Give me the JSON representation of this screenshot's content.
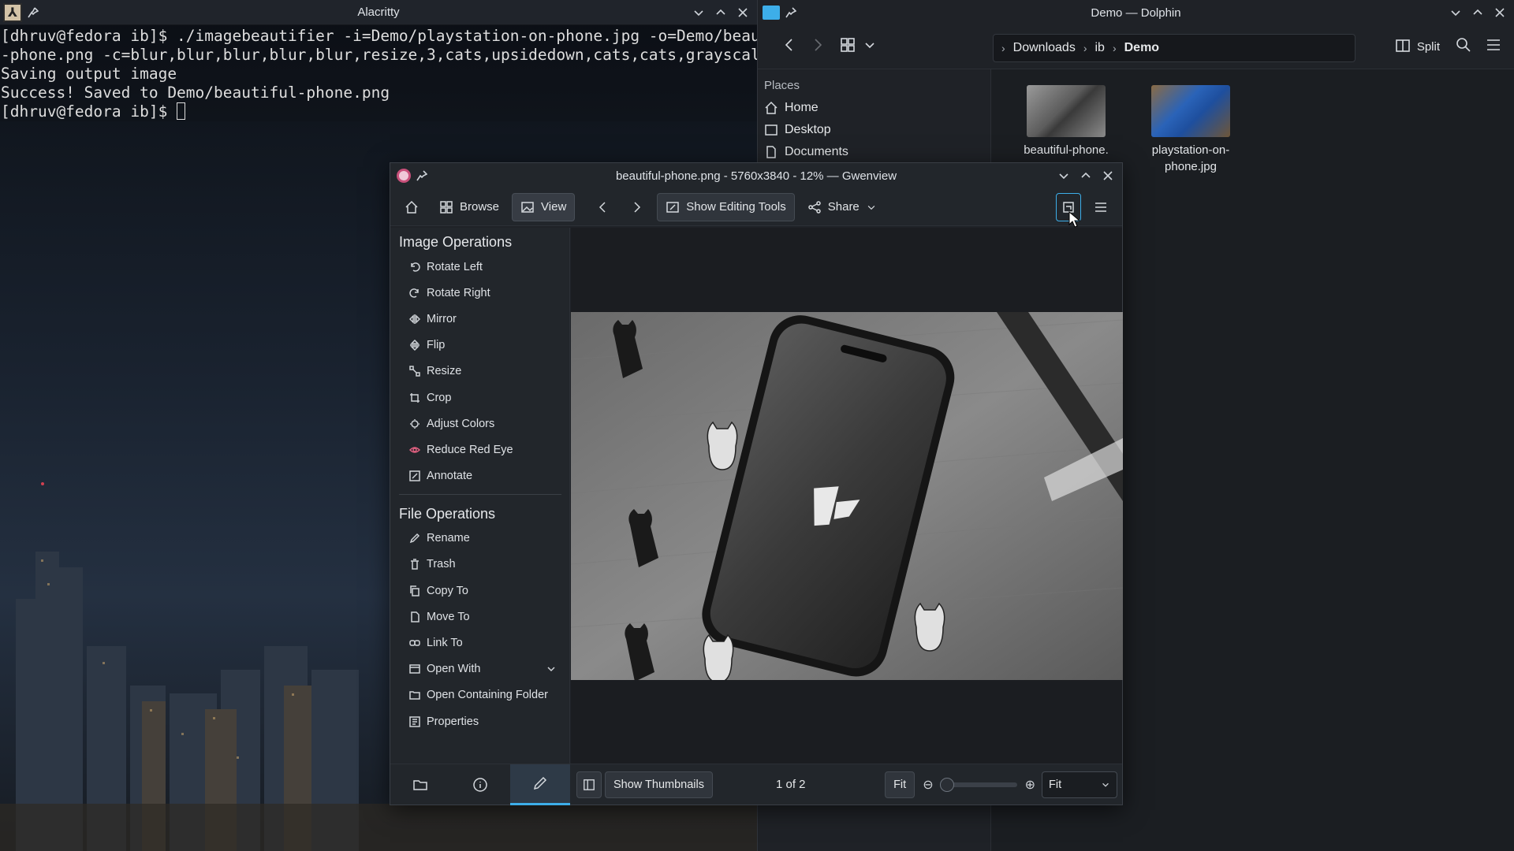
{
  "alacritty": {
    "title": "Alacritty",
    "lines": [
      "[dhruv@fedora ib]$ ./imagebeautifier -i=Demo/playstation-on-phone.jpg -o=Demo/beautiful",
      "-phone.png -c=blur,blur,blur,blur,blur,resize,3,cats,upsidedown,cats,cats,grayscale",
      "Saving output image",
      "Success! Saved to Demo/beautiful-phone.png"
    ],
    "prompt": "[dhruv@fedora ib]$ "
  },
  "dolphin": {
    "title": "Demo — Dolphin",
    "breadcrumb": [
      "Downloads",
      "ib",
      "Demo"
    ],
    "split_label": "Split",
    "places_heading": "Places",
    "places": [
      "Home",
      "Desktop",
      "Documents"
    ],
    "files": [
      "beautiful-phone.",
      "playstation-on-phone.jpg"
    ]
  },
  "gwenview": {
    "title": "beautiful-phone.png - 5760x3840 - 12% — Gwenview",
    "toolbar": {
      "browse": "Browse",
      "view": "View",
      "editing_tools": "Show Editing Tools",
      "share": "Share"
    },
    "image_ops_heading": "Image Operations",
    "image_ops": [
      "Rotate Left",
      "Rotate Right",
      "Mirror",
      "Flip",
      "Resize",
      "Crop",
      "Adjust Colors",
      "Reduce Red Eye",
      "Annotate"
    ],
    "file_ops_heading": "File Operations",
    "file_ops": [
      "Rename",
      "Trash",
      "Copy To",
      "Move To",
      "Link To",
      "Open With",
      "Open Containing Folder",
      "Properties"
    ],
    "statusbar": {
      "show_thumbnails": "Show Thumbnails",
      "position": "1 of 2",
      "fit_button": "Fit",
      "zoom_select": "Fit"
    }
  },
  "colors": {
    "accent": "#3daee9",
    "window_bg": "#1f2227"
  }
}
